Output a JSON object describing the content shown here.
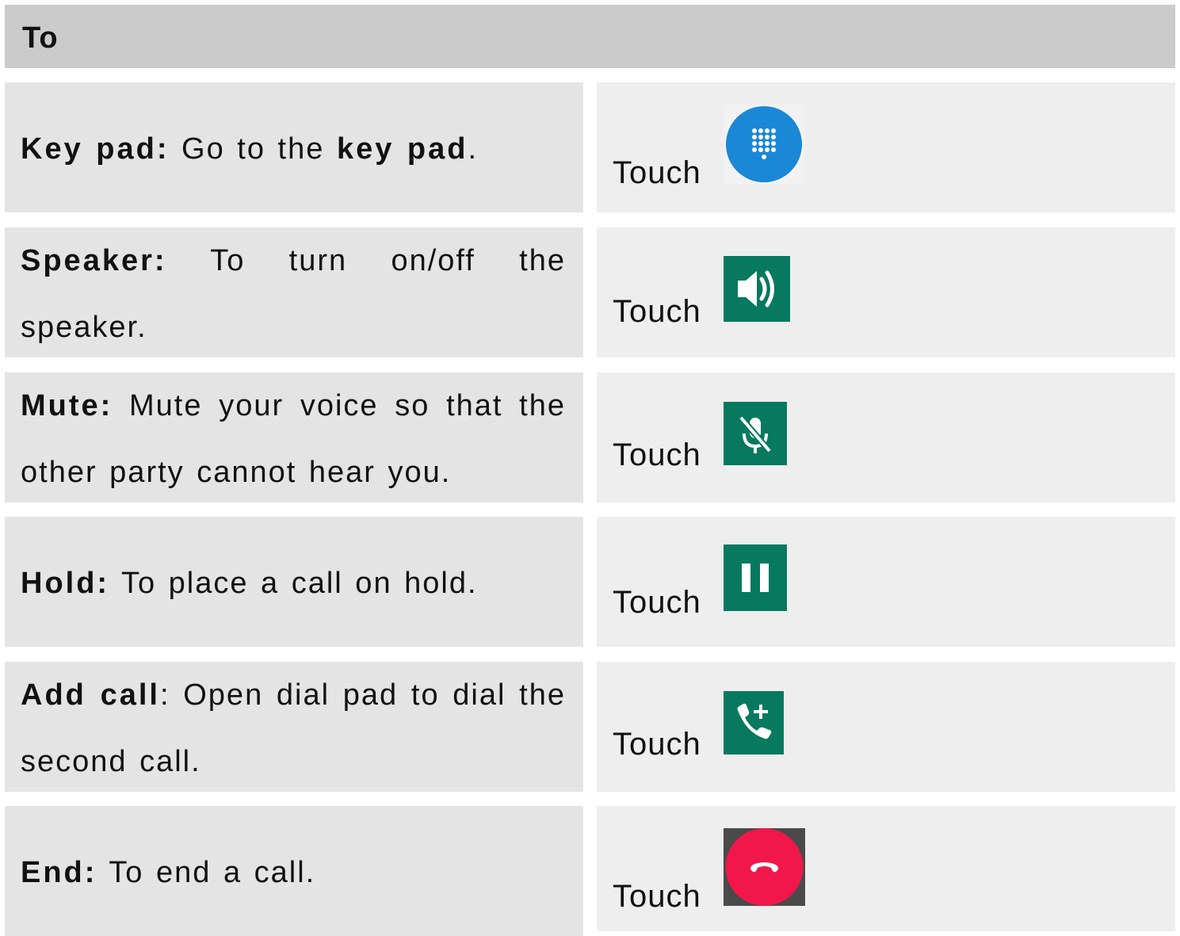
{
  "header": {
    "title": "To"
  },
  "rows": [
    {
      "term": "Key pad:",
      "text_a": " Go to the ",
      "bold_b": "key pad",
      "text_c": ".",
      "action": "Touch",
      "icon": "dialpad-icon",
      "icon_color": "#1a88d6"
    },
    {
      "term": "Speaker:",
      "text_a": " To turn on/off the speaker.",
      "action": "Touch",
      "icon": "speaker-icon",
      "icon_color": "#07795f"
    },
    {
      "term": "Mute:",
      "text_a": " Mute your voice so that the other party cannot hear you.",
      "action": "Touch",
      "icon": "mic-off-icon",
      "icon_color": "#07795f"
    },
    {
      "term": "Hold:",
      "text_a": " To place a call on hold.",
      "action": "Touch",
      "icon": "pause-icon",
      "icon_color": "#07795f"
    },
    {
      "term": "Add call",
      "text_a": ": Open dial pad to dial the second call.",
      "action": "Touch",
      "icon": "add-call-icon",
      "icon_color": "#07795f"
    },
    {
      "term": "End:",
      "text_a": " To end a call.",
      "action": "Touch",
      "icon": "end-call-icon",
      "icon_color": "#f2174a"
    }
  ]
}
